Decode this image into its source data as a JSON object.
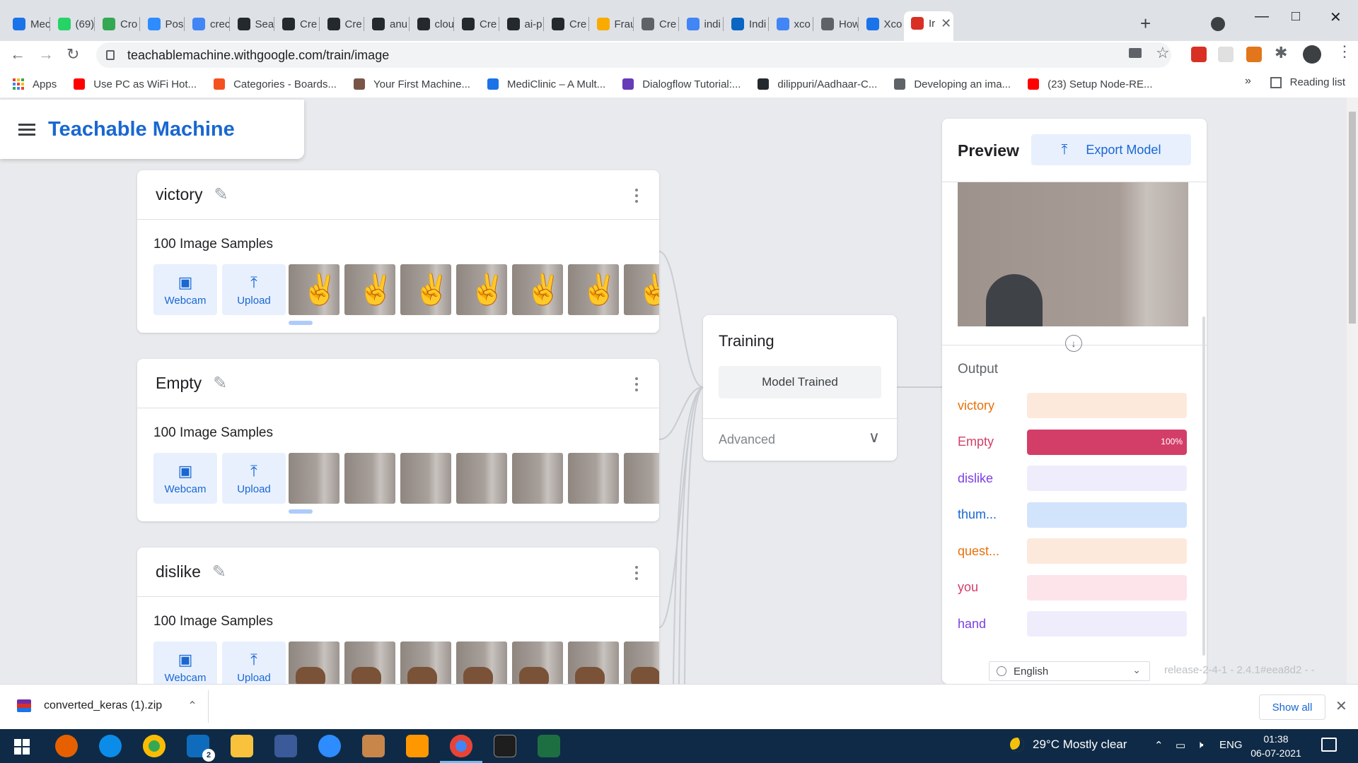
{
  "browser": {
    "tabs": [
      {
        "label": "Mec",
        "color": "#1a73e8"
      },
      {
        "label": "(69)",
        "color": "#25d366"
      },
      {
        "label": "Cro",
        "color": "#34a853"
      },
      {
        "label": "Pos",
        "color": "#2d8cff"
      },
      {
        "label": "crec",
        "color": "#4285f4"
      },
      {
        "label": "Sea",
        "color": "#24292e"
      },
      {
        "label": "Cre",
        "color": "#24292e"
      },
      {
        "label": "Cre",
        "color": "#24292e"
      },
      {
        "label": "anu",
        "color": "#24292e"
      },
      {
        "label": "clou",
        "color": "#24292e"
      },
      {
        "label": "Cre",
        "color": "#24292e"
      },
      {
        "label": "ai-p",
        "color": "#24292e"
      },
      {
        "label": "Cre",
        "color": "#24292e"
      },
      {
        "label": "Frau",
        "color": "#f9ab00"
      },
      {
        "label": "Cre",
        "color": "#5f6368"
      },
      {
        "label": "indi",
        "color": "#4285f4"
      },
      {
        "label": "Indi",
        "color": "#0a66c2"
      },
      {
        "label": "xco",
        "color": "#4285f4"
      },
      {
        "label": "How",
        "color": "#5f6368"
      },
      {
        "label": "Xco",
        "color": "#1a73e8"
      },
      {
        "label": "Ir",
        "color": "#d93025"
      }
    ],
    "new_tab": "+",
    "url": "teachablemachine.withgoogle.com/train/image",
    "bookmarks": [
      {
        "label": "Apps",
        "color": "#ea4335"
      },
      {
        "label": "Use PC as WiFi Hot...",
        "color": "#ff0000"
      },
      {
        "label": "Categories - Boards...",
        "color": "#f4511e"
      },
      {
        "label": "Your First Machine...",
        "color": "#795548"
      },
      {
        "label": "MediClinic – A Mult...",
        "color": "#1a73e8"
      },
      {
        "label": "Dialogflow Tutorial:...",
        "color": "#673ab7"
      },
      {
        "label": "dilippuri/Aadhaar-C...",
        "color": "#24292e"
      },
      {
        "label": "Developing an ima...",
        "color": "#5f6368"
      },
      {
        "label": "(23) Setup Node-RE...",
        "color": "#ff0000"
      }
    ],
    "bookmarks_more": "»",
    "reading_list": "Reading list"
  },
  "app": {
    "title": "Teachable Machine",
    "classes": [
      {
        "name": "victory",
        "samples": "100 Image Samples",
        "webcam": "Webcam",
        "upload": "Upload",
        "kind": "hand"
      },
      {
        "name": "Empty",
        "samples": "100 Image Samples",
        "webcam": "Webcam",
        "upload": "Upload",
        "kind": "empty"
      },
      {
        "name": "dislike",
        "samples": "100 Image Samples",
        "webcam": "Webcam",
        "upload": "Upload",
        "kind": "fist"
      }
    ],
    "training": {
      "title": "Training",
      "button": "Model Trained",
      "advanced": "Advanced"
    },
    "preview": {
      "title": "Preview",
      "export": "Export Model",
      "output_title": "Output",
      "outputs": [
        {
          "label": "victory",
          "color": "#e8710a",
          "track": "#fde9dc",
          "value": 0,
          "pct": ""
        },
        {
          "label": "Empty",
          "color": "#d33e68",
          "track": "#fbe4ea",
          "value": 1.0,
          "pct": "100%"
        },
        {
          "label": "dislike",
          "color": "#7b3fe4",
          "track": "#efedfc",
          "value": 0,
          "pct": ""
        },
        {
          "label": "thum...",
          "color": "#1967d2",
          "track": "#d2e3fc",
          "value": 0,
          "pct": ""
        },
        {
          "label": "quest...",
          "color": "#e8710a",
          "track": "#fde9dc",
          "value": 0,
          "pct": ""
        },
        {
          "label": "you",
          "color": "#d33e68",
          "track": "#fce4ea",
          "value": 0,
          "pct": ""
        },
        {
          "label": "hand",
          "color": "#7b3fe4",
          "track": "#efedfc",
          "value": 0,
          "pct": ""
        }
      ]
    },
    "language": "English",
    "release": "release-2-4-1 - 2.4.1#eea8d2 - -"
  },
  "downloads": {
    "file": "converted_keras (1).zip",
    "show_all": "Show all"
  },
  "taskbar": {
    "weather": "29°C  Mostly clear",
    "lang": "ENG",
    "time": "01:38",
    "date": "06-07-2021",
    "badge": "2"
  }
}
